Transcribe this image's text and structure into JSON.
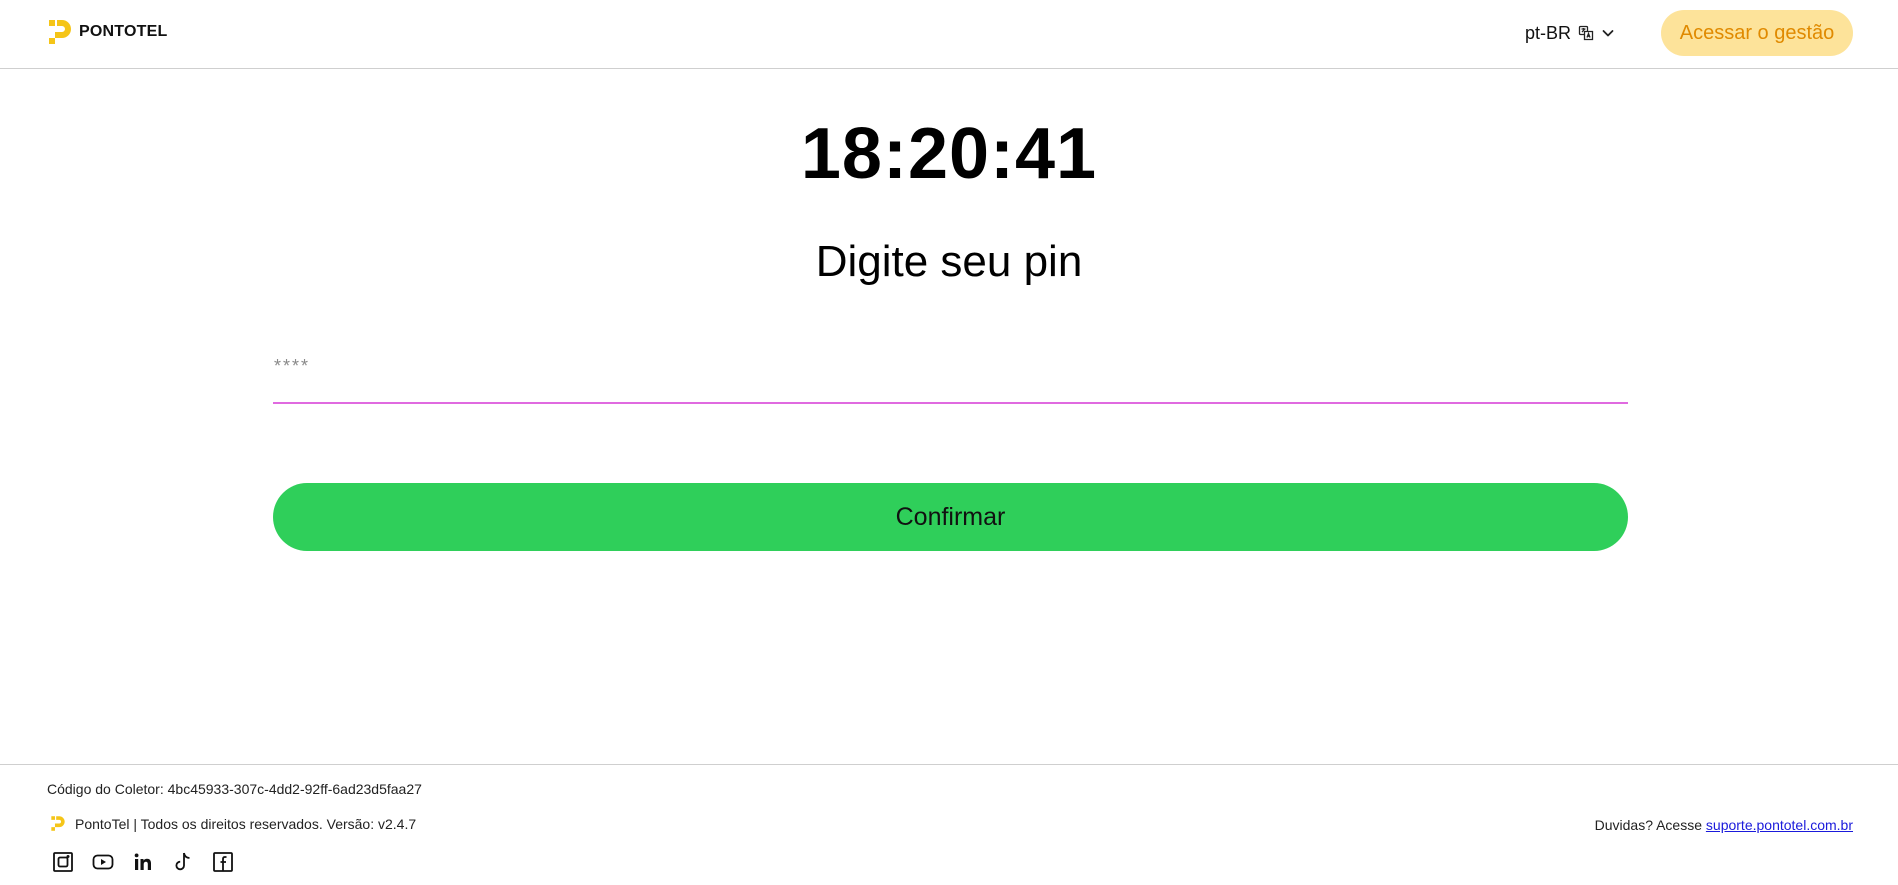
{
  "header": {
    "brand_name": "PONTOTEL",
    "language": "pt-BR",
    "access_button": "Acessar o gestão"
  },
  "main": {
    "clock": "18:20:41",
    "prompt": "Digite seu pin",
    "pin_placeholder": "****",
    "pin_value": "",
    "confirm_button": "Confirmar"
  },
  "footer": {
    "collector_code": "Código do Coletor: 4bc45933-307c-4dd2-92ff-6ad23d5faa27",
    "rights": "PontoTel | Todos os direitos reservados. Versão: v2.4.7",
    "help_prefix": "Duvidas? Acesse",
    "help_link": "suporte.pontotel.com.br",
    "socials": [
      "instagram-icon",
      "youtube-icon",
      "linkedin-icon",
      "tiktok-icon",
      "facebook-icon"
    ]
  },
  "colors": {
    "brand_yellow": "#f5c518",
    "access_bg": "#fde39a",
    "access_text": "#e08a00",
    "confirm_green": "#2fcf5a",
    "input_underline": "#e06ae0",
    "link_blue": "#1a1adb"
  }
}
